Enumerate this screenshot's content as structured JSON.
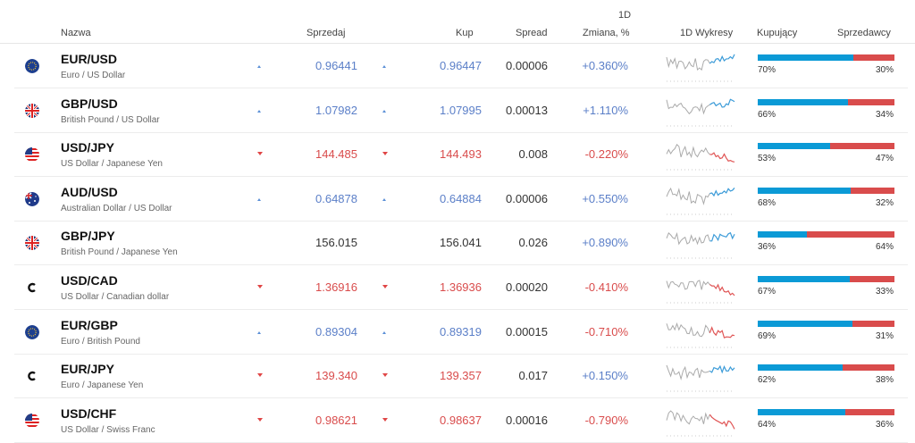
{
  "header": {
    "nazwa": "Nazwa",
    "sprzedaj": "Sprzedaj",
    "kup": "Kup",
    "spread": "Spread",
    "zmiana_period": "1D",
    "zmiana": "Zmiana, %",
    "wykresy": "1D Wykresy",
    "kupujacy": "Kupujący",
    "sprzedawcy": "Sprzedawcy"
  },
  "colors": {
    "up": "#5b7fc8",
    "down": "#d94c4c",
    "buyers_bar": "#0b9ad6",
    "sellers_bar": "#d94c4c",
    "spark_gray": "#aaaaaa",
    "spark_blue": "#3b9bd8",
    "spark_red": "#e05555"
  },
  "rows": [
    {
      "flag": "eu-flag-icon",
      "symbol": "EUR/USD",
      "description": "Euro / US Dollar",
      "direction": "up",
      "sell": "0.96441",
      "buy": "0.96447",
      "spread": "0.00006",
      "change": "+0.360%",
      "buyers": 70,
      "buyers_label": "70%",
      "sellers_label": "30%"
    },
    {
      "flag": "uk-flag-icon",
      "symbol": "GBP/USD",
      "description": "British Pound / US Dollar",
      "direction": "up",
      "sell": "1.07982",
      "buy": "1.07995",
      "spread": "0.00013",
      "change": "+1.110%",
      "buyers": 66,
      "buyers_label": "66%",
      "sellers_label": "34%"
    },
    {
      "flag": "us-flag-icon",
      "symbol": "USD/JPY",
      "description": "US Dollar / Japanese Yen",
      "direction": "down",
      "sell": "144.485",
      "buy": "144.493",
      "spread": "0.008",
      "change": "-0.220%",
      "buyers": 53,
      "buyers_label": "53%",
      "sellers_label": "47%"
    },
    {
      "flag": "au-flag-icon",
      "symbol": "AUD/USD",
      "description": "Australian Dollar / US Dollar",
      "direction": "up",
      "sell": "0.64878",
      "buy": "0.64884",
      "spread": "0.00006",
      "change": "+0.550%",
      "buyers": 68,
      "buyers_label": "68%",
      "sellers_label": "32%"
    },
    {
      "flag": "uk-flag-icon",
      "symbol": "GBP/JPY",
      "description": "British Pound / Japanese Yen",
      "direction": "neutral",
      "sell": "156.015",
      "buy": "156.041",
      "spread": "0.026",
      "change": "+0.890%",
      "buyers": 36,
      "buyers_label": "36%",
      "sellers_label": "64%"
    },
    {
      "flag": "currency-c-icon",
      "symbol": "USD/CAD",
      "description": "US Dollar / Canadian dollar",
      "direction": "down",
      "sell": "1.36916",
      "buy": "1.36936",
      "spread": "0.00020",
      "change": "-0.410%",
      "buyers": 67,
      "buyers_label": "67%",
      "sellers_label": "33%"
    },
    {
      "flag": "eu-flag-icon",
      "symbol": "EUR/GBP",
      "description": "Euro / British Pound",
      "direction": "up",
      "sell": "0.89304",
      "buy": "0.89319",
      "spread": "0.00015",
      "change": "-0.710%",
      "buyers": 69,
      "buyers_label": "69%",
      "sellers_label": "31%"
    },
    {
      "flag": "currency-c-icon",
      "symbol": "EUR/JPY",
      "description": "Euro / Japanese Yen",
      "direction": "down",
      "sell": "139.340",
      "buy": "139.357",
      "spread": "0.017",
      "change": "+0.150%",
      "buyers": 62,
      "buyers_label": "62%",
      "sellers_label": "38%"
    },
    {
      "flag": "us-flag-icon",
      "symbol": "USD/CHF",
      "description": "US Dollar / Swiss Franc",
      "direction": "down",
      "sell": "0.98621",
      "buy": "0.98637",
      "spread": "0.00016",
      "change": "-0.790%",
      "buyers": 64,
      "buyers_label": "64%",
      "sellers_label": "36%"
    }
  ]
}
